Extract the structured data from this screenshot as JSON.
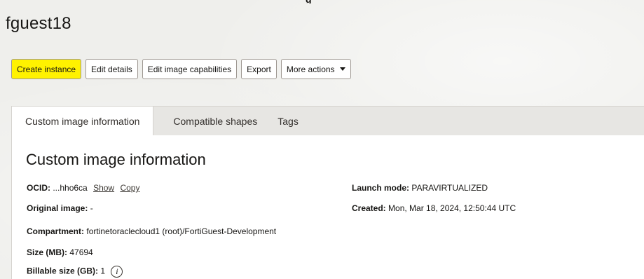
{
  "header": {
    "top_cut_text": "g",
    "title": "fguest18"
  },
  "toolbar": {
    "create_instance": "Create instance",
    "edit_details": "Edit details",
    "edit_image_capabilities": "Edit image capabilities",
    "export": "Export",
    "more_actions": "More actions"
  },
  "tabs": [
    {
      "label": "Custom image information"
    },
    {
      "label": "Compatible shapes"
    },
    {
      "label": "Tags"
    }
  ],
  "details": {
    "section_title": "Custom image information",
    "ocid_label": "OCID:",
    "ocid_value": "...hho6ca",
    "show_link": "Show",
    "copy_link": "Copy",
    "original_image_label": "Original image:",
    "original_image_value": "-",
    "compartment_label": "Compartment:",
    "compartment_value": "fortinetoraclecloud1 (root)/FortiGuest-Development",
    "size_label": "Size (MB):",
    "size_value": "47694",
    "billable_label": "Billable size (GB):",
    "billable_value": "1",
    "launch_mode_label": "Launch mode:",
    "launch_mode_value": "PARAVIRTUALIZED",
    "created_label": "Created:",
    "created_value": "Mon, Mar 18, 2024, 12:50:44 UTC"
  },
  "colors": {
    "highlight": "#fff200",
    "page_background": "#efefec"
  },
  "icons": {
    "more_actions_caret": "caret-down-icon",
    "billable_info": "info-icon"
  }
}
